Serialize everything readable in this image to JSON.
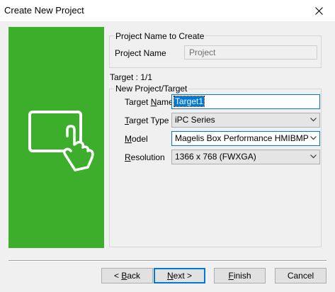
{
  "window": {
    "title": "Create New Project"
  },
  "project_group": {
    "legend": "Project Name to Create",
    "name_label": "Project Name",
    "name_value": "Project"
  },
  "target_count": "Target : 1/1",
  "target_group": {
    "legend": "New Project/Target",
    "target_name_label_pre": "Target ",
    "target_name_label_acc": "N",
    "target_name_label_post": "ame",
    "target_name_value": "Target1",
    "target_type_label_acc": "T",
    "target_type_label_post": "arget Type",
    "target_type_value": "iPC Series",
    "model_label_acc": "M",
    "model_label_post": "odel",
    "model_value": "Magelis Box Performance HMIBMP",
    "resolution_label_acc": "R",
    "resolution_label_post": "esolution",
    "resolution_value": "1366 x 768 (FWXGA)"
  },
  "buttons": {
    "back_pre": "< ",
    "back_acc": "B",
    "back_post": "ack",
    "next_acc": "N",
    "next_post": "ext >",
    "finish_acc": "F",
    "finish_post": "inish",
    "cancel": "Cancel"
  },
  "colors": {
    "accent": "#3dae2b",
    "focus": "#0078d7"
  },
  "icons": {
    "close": "close-icon",
    "panel": "touch-screen-icon",
    "dropdown": "chevron-down-icon"
  }
}
